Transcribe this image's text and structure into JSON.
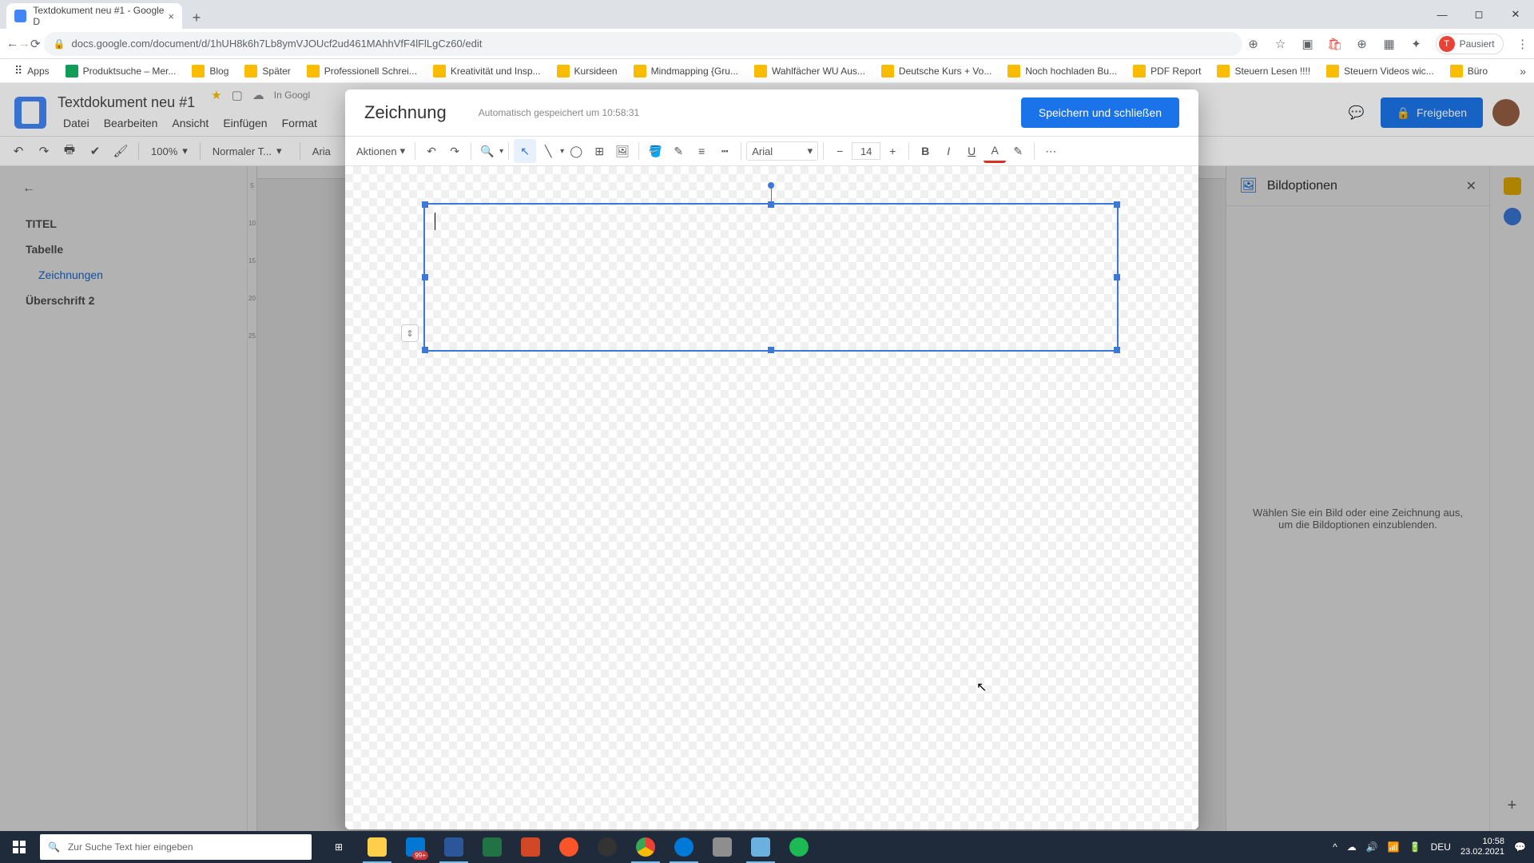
{
  "browser": {
    "tab_title": "Textdokument neu #1 - Google D",
    "url": "docs.google.com/document/d/1hUH8k6h7Lb8ymVJOUcf2ud461MAhhVfF4lFlLgCz60/edit",
    "profile_label": "Pausiert"
  },
  "bookmarks": [
    "Apps",
    "Produktsuche – Mer...",
    "Blog",
    "Später",
    "Professionell Schrei...",
    "Kreativität und Insp...",
    "Kursideen",
    "Mindmapping {Gru...",
    "Wahlfächer WU Aus...",
    "Deutsche Kurs + Vo...",
    "Noch hochladen Bu...",
    "PDF Report",
    "Steuern Lesen !!!!",
    "Steuern Videos wic...",
    "Büro"
  ],
  "docs": {
    "title": "Textdokument neu #1",
    "status": "In Googl",
    "menus": [
      "Datei",
      "Bearbeiten",
      "Ansicht",
      "Einfügen",
      "Format"
    ],
    "share": "Freigeben",
    "toolbar": {
      "zoom": "100%",
      "style": "Normaler T...",
      "font_trunc": "Aria"
    },
    "outline": {
      "items": [
        "TITEL",
        "Tabelle"
      ],
      "sub": "Zeichnungen",
      "item3": "Überschrift 2"
    },
    "image_options": {
      "title": "Bildoptionen",
      "placeholder": "Wählen Sie ein Bild oder eine Zeichnung aus, um die Bildoptionen einzublenden."
    },
    "v_ruler": [
      "",
      "",
      "5",
      "",
      "10",
      "",
      "15",
      "",
      "20",
      "",
      "25",
      ""
    ]
  },
  "drawing": {
    "title": "Zeichnung",
    "saved": "Automatisch gespeichert um 10:58:31",
    "close": "Speichern und schließen",
    "actions": "Aktionen",
    "font": "Arial",
    "size": "14"
  },
  "taskbar": {
    "search_placeholder": "Zur Suche Text hier eingeben",
    "lang": "DEU",
    "time": "10:58",
    "date": "23.02.2021",
    "badge": "99+"
  }
}
